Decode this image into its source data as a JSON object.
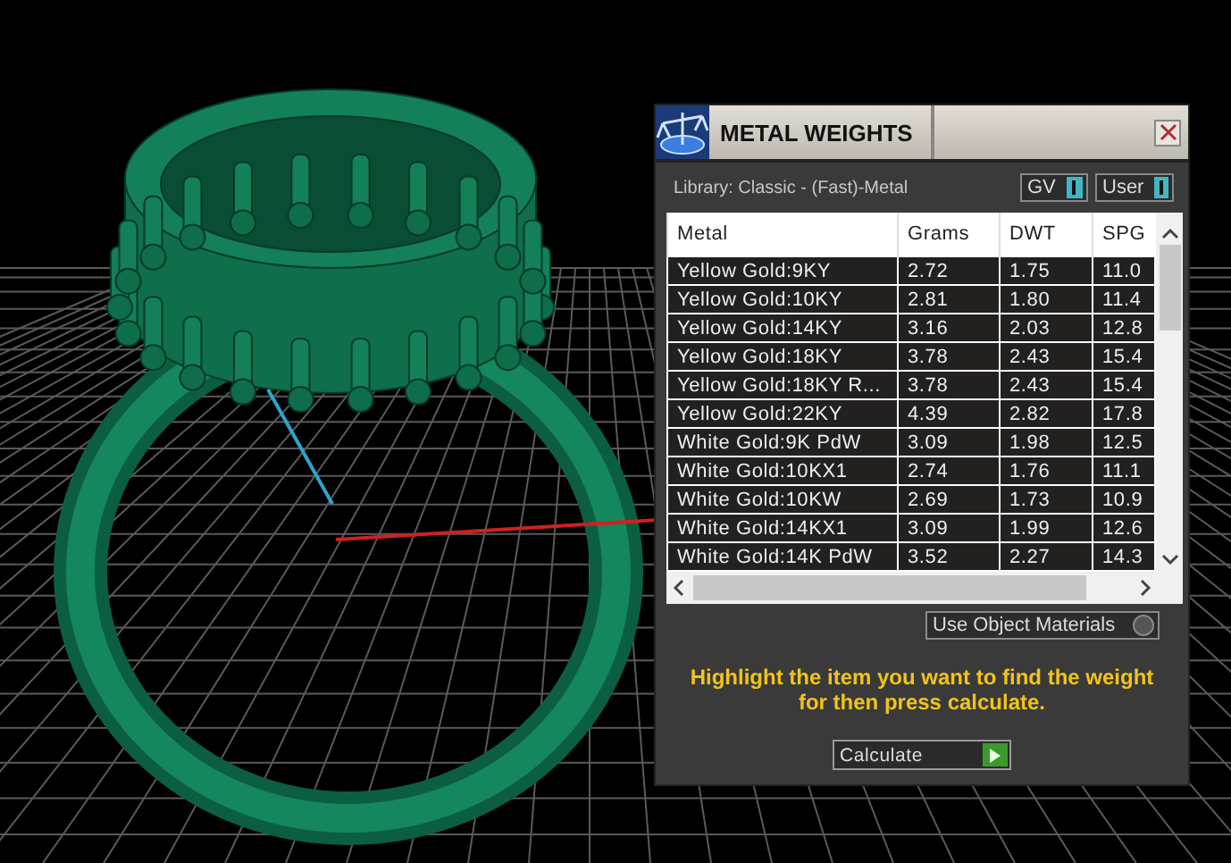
{
  "window": {
    "title": "METAL WEIGHTS"
  },
  "library": "Library: Classic - (Fast)-Metal",
  "toggles": [
    {
      "label": "GV",
      "on": true
    },
    {
      "label": "User",
      "on": true
    }
  ],
  "table": {
    "columns": [
      "Metal",
      "Grams",
      "DWT",
      "SPG"
    ],
    "rows": [
      [
        "Yellow Gold:9KY",
        "2.72",
        "1.75",
        "11.0"
      ],
      [
        "Yellow Gold:10KY",
        "2.81",
        "1.80",
        "11.4"
      ],
      [
        "Yellow Gold:14KY",
        "3.16",
        "2.03",
        "12.8"
      ],
      [
        "Yellow Gold:18KY",
        "3.78",
        "2.43",
        "15.4"
      ],
      [
        "Yellow Gold:18KY R...",
        "3.78",
        "2.43",
        "15.4"
      ],
      [
        "Yellow Gold:22KY",
        "4.39",
        "2.82",
        "17.8"
      ],
      [
        "White Gold:9K PdW",
        "3.09",
        "1.98",
        "12.5"
      ],
      [
        "White Gold:10KX1",
        "2.74",
        "1.76",
        "11.1"
      ],
      [
        "White Gold:10KW",
        "2.69",
        "1.73",
        "10.9"
      ],
      [
        "White Gold:14KX1",
        "3.09",
        "1.99",
        "12.6"
      ],
      [
        "White Gold:14K PdW",
        "3.52",
        "2.27",
        "14.3"
      ]
    ]
  },
  "use_object_materials": {
    "label": "Use Object Materials",
    "on": false
  },
  "message": "Highlight the item you want to find the weight for then press calculate.",
  "calculate_button": "Calculate"
}
